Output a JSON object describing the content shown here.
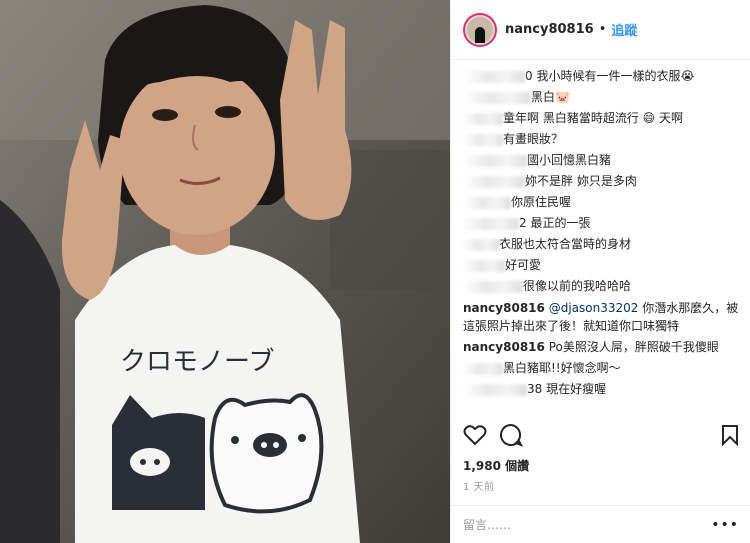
{
  "header": {
    "username": "nancy80816",
    "dot": "•",
    "follow_label": "追蹤"
  },
  "comments": [
    {
      "user": "",
      "text": "0 我小時候有一件一樣的衣服😭"
    },
    {
      "user": "",
      "text": "黑白🐷"
    },
    {
      "user": "",
      "text": "童年啊 黑白豬當時超流行 😄 天啊"
    },
    {
      "user": "",
      "text": "有畫眼妝？"
    },
    {
      "user": "",
      "text": "國小回憶黑白豬"
    },
    {
      "user": "",
      "text": "妳不是胖 妳只是多肉"
    },
    {
      "user": "",
      "text": "你原住民喔"
    },
    {
      "user": "",
      "text": "2 最正的一張"
    },
    {
      "user": "",
      "text": "衣服也太符合當時的身材"
    },
    {
      "user": "",
      "text": "好可愛"
    },
    {
      "user": "",
      "text": "很像以前的我哈哈哈"
    },
    {
      "user": "nancy80816",
      "mention": "@djason33202",
      "text": " 你潛水那麼久，被這張照片掉出來了後！就知道你口味獨特"
    },
    {
      "user": "nancy80816",
      "text": " Po美照沒人屌，胖照破千我傻眼"
    },
    {
      "user": "",
      "text": "黑白豬耶!!好懷念啊～"
    },
    {
      "user": "",
      "text": "38 現在好瘦喔"
    }
  ],
  "photo": {
    "shirt_text": "クロモノーブ"
  },
  "likes": "1,980 個讚",
  "time": "1 天前",
  "add_comment_placeholder": "留言……",
  "more_symbol": "•••"
}
